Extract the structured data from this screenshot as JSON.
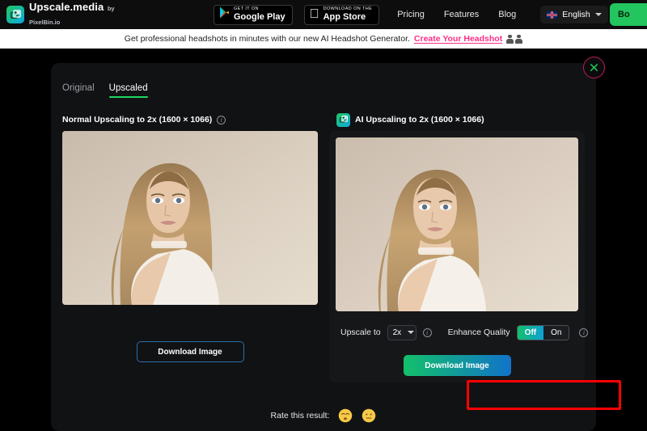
{
  "navbar": {
    "brand_title": "Upscale.media",
    "brand_sub": "by PixelBin.io",
    "brand_icon": "upscale-arrow-icon",
    "google_play": {
      "small": "GET IT ON",
      "big": "Google Play",
      "icon": "google-play-icon"
    },
    "app_store": {
      "small": "Download on the",
      "big": "App Store",
      "icon": "apple-icon"
    },
    "links": [
      "Pricing",
      "Features",
      "Blog"
    ],
    "language": {
      "value": "English",
      "flag": "uk-flag-icon",
      "chevron": "chevron-down-icon"
    },
    "cta_label": "Bo",
    "cta_color": "#22c55e"
  },
  "promo": {
    "text": "Get professional headshots in minutes with our new AI Headshot Generator.",
    "link": "Create Your Headshot",
    "link_color": "#ff2d87",
    "icons": [
      "person-icon",
      "person-icon"
    ]
  },
  "modal": {
    "close_icon": "close-icon",
    "tabs": [
      {
        "label": "Original",
        "active": false
      },
      {
        "label": "Upscaled",
        "active": true
      }
    ],
    "active_tab_color": "#1ed760",
    "left_panel": {
      "title": "Normal Upscaling to 2x (1600 × 1066)",
      "info_icon": "info-icon",
      "image_alt": "portrait-of-woman-blonde-hair",
      "download_label": "Download Image"
    },
    "right_panel": {
      "title": "AI Upscaling to 2x (1600 × 1066)",
      "badge_icon": "ai-upscale-icon",
      "image_alt": "portrait-of-woman-blonde-hair-ai-upscaled",
      "upscale_label": "Upscale to",
      "upscale_value": "2x",
      "upscale_info_icon": "info-icon",
      "enhance_label": "Enhance Quality",
      "enhance_off": "Off",
      "enhance_on": "On",
      "enhance_selected": "Off",
      "enhance_info_icon": "info-icon",
      "download_label": "Download Image",
      "highlight_color": "#ff0000"
    },
    "rating": {
      "label": "Rate this result:",
      "emojis": [
        "disappointed-face-emoji",
        "neutral-face-emoji"
      ]
    }
  }
}
